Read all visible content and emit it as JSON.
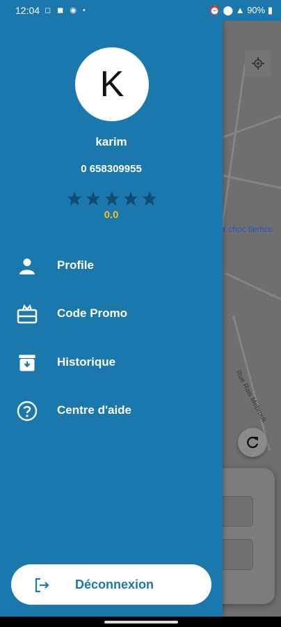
{
  "status_bar": {
    "time": "12:04",
    "battery": "90%"
  },
  "drawer": {
    "avatar_letter": "K",
    "username": "karim",
    "phone": "0 658309955",
    "rating": {
      "stars": 5,
      "value": "0.0"
    },
    "menu": [
      {
        "label": "Profile",
        "icon": "person-icon"
      },
      {
        "label": "Code Promo",
        "icon": "gift-card-icon"
      },
      {
        "label": "Historique",
        "icon": "archive-icon"
      },
      {
        "label": "Centre d'aide",
        "icon": "help-circle-icon"
      }
    ],
    "logout_label": "Déconnexion"
  },
  "map": {
    "street_label": "x choc tlemce",
    "road_label": "Rue Rais Mebrouk"
  },
  "colors": {
    "drawer_bg": "#1a78ad",
    "star_color": "#0f4c71",
    "rating_color": "#f2c21b"
  }
}
